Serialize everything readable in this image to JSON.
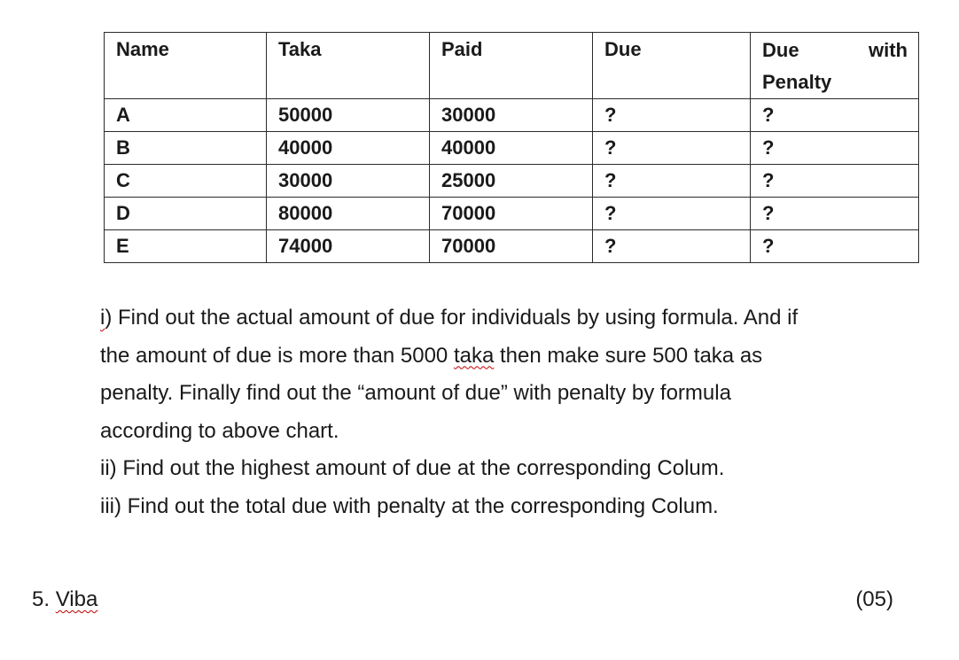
{
  "table": {
    "headers": {
      "name": "Name",
      "taka": "Taka",
      "paid": "Paid",
      "due": "Due",
      "penalty_line1_a": "Due",
      "penalty_line1_b": "with",
      "penalty_line2": "Penalty"
    },
    "rows": [
      {
        "name": "A",
        "taka": "50000",
        "paid": "30000",
        "due": "?",
        "penalty": "?"
      },
      {
        "name": "B",
        "taka": "40000",
        "paid": "40000",
        "due": "?",
        "penalty": "?"
      },
      {
        "name": "C",
        "taka": "30000",
        "paid": "25000",
        "due": "?",
        "penalty": "?"
      },
      {
        "name": "D",
        "taka": "80000",
        "paid": "70000",
        "due": "?",
        "penalty": "?"
      },
      {
        "name": "E",
        "taka": "74000",
        "paid": "70000",
        "due": "?",
        "penalty": "?"
      }
    ]
  },
  "questions": {
    "q1_prefix": "i",
    "q1_line1_rest": ") Find out the actual amount of due for individuals by using formula. And if",
    "q1_line2_a": "the amount of due is more than 5000 ",
    "q1_line2_taka": "taka",
    "q1_line2_b": " then make sure 500 taka as",
    "q1_line3": "penalty. Finally find out the “amount of due” with penalty by formula",
    "q1_line4": "according to above chart.",
    "q2": "ii) Find out the highest amount of due at the corresponding Colum.",
    "q3": "iii) Find out the total due with penalty at the corresponding Colum."
  },
  "footer": {
    "number": "5. ",
    "title": "Viba",
    "marks": "(05)"
  }
}
